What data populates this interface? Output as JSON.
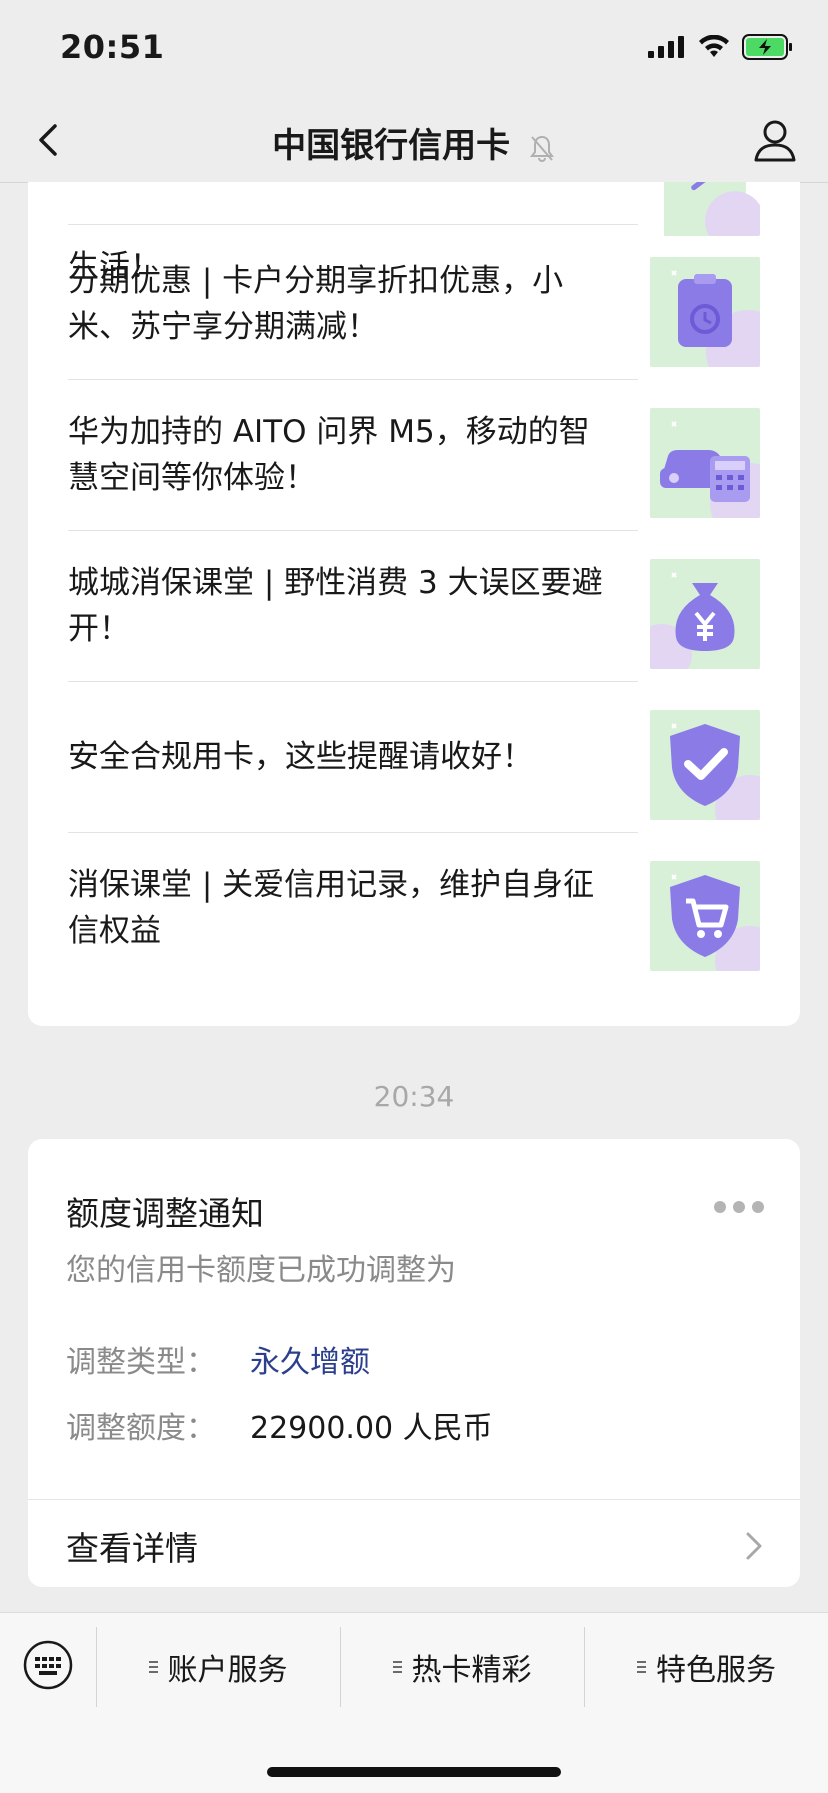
{
  "status_bar": {
    "time": "20:51"
  },
  "nav": {
    "title": "中国银行信用卡"
  },
  "articles": [
    {
      "title": "生活！"
    },
    {
      "title": "分期优惠 | 卡户分期享折扣优惠，小米、苏宁享分期满减！"
    },
    {
      "title": "华为加持的 AITO 问界 M5，移动的智慧空间等你体验！"
    },
    {
      "title": "城城消保课堂 | 野性消费 3 大误区要避开！"
    },
    {
      "title": "安全合规用卡，这些提醒请收好！"
    },
    {
      "title": "消保课堂 | 关爱信用记录，维护自身征信权益"
    }
  ],
  "time_label": "20:34",
  "notice": {
    "title": "额度调整通知",
    "subtitle": "您的信用卡额度已成功调整为",
    "fields": [
      {
        "label": "调整类型：",
        "value": "永久增额"
      },
      {
        "label": "调整额度：",
        "value": "22900.00 人民币"
      }
    ],
    "detail_label": "查看详情"
  },
  "menu": {
    "items": [
      {
        "label": "账户服务"
      },
      {
        "label": "热卡精彩"
      },
      {
        "label": "特色服务"
      }
    ]
  },
  "colors": {
    "accent_link": "#2c3f8c",
    "thumb_purple": "#8b7be6",
    "thumb_green": "#d8efd8"
  }
}
